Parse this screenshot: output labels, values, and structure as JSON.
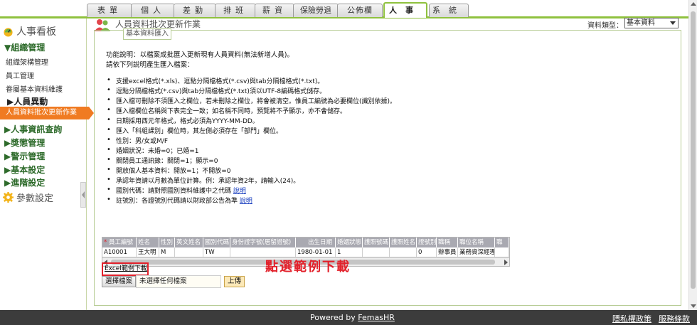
{
  "tabs": [
    {
      "label": "表單"
    },
    {
      "label": "個人"
    },
    {
      "label": "差勤"
    },
    {
      "label": "排班"
    },
    {
      "label": "薪資"
    },
    {
      "label": "保險勞退"
    },
    {
      "label": "公佈欄"
    },
    {
      "label": "人事"
    },
    {
      "label": "系統"
    }
  ],
  "sidebar": {
    "header": "人事看板",
    "group_org": "▼組織管理",
    "items": [
      "組織架構管理",
      "員工管理",
      "眷屬基本資料維護"
    ],
    "group_change": "▶人員異動",
    "selected_item": "人員資料批次更新作業",
    "groups": [
      "▶人事資訊查詢",
      "▶獎懲管理",
      "▶警示管理",
      "▶基本設定",
      "▶進階設定"
    ],
    "settings": "參數設定"
  },
  "page": {
    "title": "人員資料批次更新作業",
    "type_label": "資料類型：",
    "type_value": "基本資料",
    "legend": "基本資料匯入",
    "desc1": "功能說明：以檔案成批匯入更新現有人員資料(無法新增人員)。",
    "desc2": "請依下列說明產生匯入檔案：",
    "bullets": [
      "支援excel格式(*.xls)、逗點分隔檔格式(*.csv)與tab分隔檔格式(*.txt)。",
      "逗點分隔檔格式(*.csv)與tab分隔檔格式(*.txt)須以UTF-8編碼格式儲存。",
      "匯入檔可刪除不須匯入之欄位，若未刪除之欄位，將會被清空。惟員工編號為必要欄位(識別依據)。",
      "匯入檔欄位名稱與下表完全一致；如名稱不同時，預覽將不予顯示，亦不會儲存。",
      "日期採用西元年格式，格式必須為YYYY-MM-DD。",
      "匯入「科組課別」欄位時，其左側必須存在「部門」欄位。",
      "性別：男/女或M/F",
      "婚姻狀況：未婚=0；已婚=1",
      "關閉員工通訊錄：關閉=1；顯示=0",
      "開放個人基本資料：開放=1；不開放=0",
      "承認年資請以月數為單位計算。例：承認年資2年，請輸入(24)。"
    ],
    "bullet_country": "國別代碼：請對照國別資料維護中之代碼",
    "bullet_tax": "註號別：各證號別代碼請以財政部公告為準",
    "link_label": "說明",
    "grid": {
      "required_mark": "*",
      "headers": [
        "員工編號",
        "姓名",
        "性別",
        "英文姓名",
        "國別代碼",
        "身份證字號(居留證號)",
        "出生日期",
        "婚姻狀態",
        "護照號碼",
        "護照姓名",
        "證號別",
        "職稱",
        "職位名稱",
        "職"
      ],
      "row": [
        "A10001",
        "王大明",
        "M",
        "",
        "TW",
        "",
        "1980-01-01",
        "1",
        "",
        "",
        "0",
        "辦事員",
        "業務資深經理",
        ""
      ]
    },
    "excel_link": "Excel範例下載",
    "annotation": "點選範例下載",
    "choose_file": "選擇檔案",
    "no_file": "未選擇任何檔案",
    "upload": "上傳"
  },
  "footer": {
    "powered": "Powered by",
    "brand": "FemasHR",
    "privacy": "隱私權政策",
    "terms": "服務條款"
  }
}
